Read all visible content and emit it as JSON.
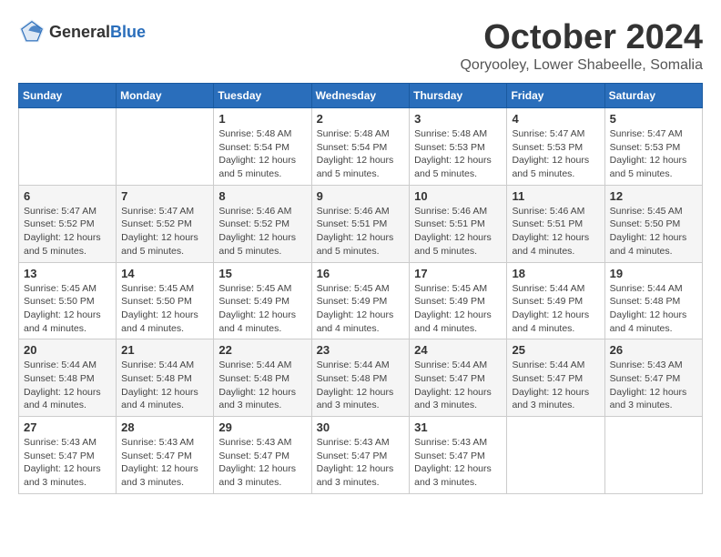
{
  "header": {
    "logo_general": "General",
    "logo_blue": "Blue",
    "month": "October 2024",
    "location": "Qoryooley, Lower Shabeelle, Somalia"
  },
  "weekdays": [
    "Sunday",
    "Monday",
    "Tuesday",
    "Wednesday",
    "Thursday",
    "Friday",
    "Saturday"
  ],
  "weeks": [
    [
      {
        "day": "",
        "sunrise": "",
        "sunset": "",
        "daylight": ""
      },
      {
        "day": "",
        "sunrise": "",
        "sunset": "",
        "daylight": ""
      },
      {
        "day": "1",
        "sunrise": "Sunrise: 5:48 AM",
        "sunset": "Sunset: 5:54 PM",
        "daylight": "Daylight: 12 hours and 5 minutes."
      },
      {
        "day": "2",
        "sunrise": "Sunrise: 5:48 AM",
        "sunset": "Sunset: 5:54 PM",
        "daylight": "Daylight: 12 hours and 5 minutes."
      },
      {
        "day": "3",
        "sunrise": "Sunrise: 5:48 AM",
        "sunset": "Sunset: 5:53 PM",
        "daylight": "Daylight: 12 hours and 5 minutes."
      },
      {
        "day": "4",
        "sunrise": "Sunrise: 5:47 AM",
        "sunset": "Sunset: 5:53 PM",
        "daylight": "Daylight: 12 hours and 5 minutes."
      },
      {
        "day": "5",
        "sunrise": "Sunrise: 5:47 AM",
        "sunset": "Sunset: 5:53 PM",
        "daylight": "Daylight: 12 hours and 5 minutes."
      }
    ],
    [
      {
        "day": "6",
        "sunrise": "Sunrise: 5:47 AM",
        "sunset": "Sunset: 5:52 PM",
        "daylight": "Daylight: 12 hours and 5 minutes."
      },
      {
        "day": "7",
        "sunrise": "Sunrise: 5:47 AM",
        "sunset": "Sunset: 5:52 PM",
        "daylight": "Daylight: 12 hours and 5 minutes."
      },
      {
        "day": "8",
        "sunrise": "Sunrise: 5:46 AM",
        "sunset": "Sunset: 5:52 PM",
        "daylight": "Daylight: 12 hours and 5 minutes."
      },
      {
        "day": "9",
        "sunrise": "Sunrise: 5:46 AM",
        "sunset": "Sunset: 5:51 PM",
        "daylight": "Daylight: 12 hours and 5 minutes."
      },
      {
        "day": "10",
        "sunrise": "Sunrise: 5:46 AM",
        "sunset": "Sunset: 5:51 PM",
        "daylight": "Daylight: 12 hours and 5 minutes."
      },
      {
        "day": "11",
        "sunrise": "Sunrise: 5:46 AM",
        "sunset": "Sunset: 5:51 PM",
        "daylight": "Daylight: 12 hours and 4 minutes."
      },
      {
        "day": "12",
        "sunrise": "Sunrise: 5:45 AM",
        "sunset": "Sunset: 5:50 PM",
        "daylight": "Daylight: 12 hours and 4 minutes."
      }
    ],
    [
      {
        "day": "13",
        "sunrise": "Sunrise: 5:45 AM",
        "sunset": "Sunset: 5:50 PM",
        "daylight": "Daylight: 12 hours and 4 minutes."
      },
      {
        "day": "14",
        "sunrise": "Sunrise: 5:45 AM",
        "sunset": "Sunset: 5:50 PM",
        "daylight": "Daylight: 12 hours and 4 minutes."
      },
      {
        "day": "15",
        "sunrise": "Sunrise: 5:45 AM",
        "sunset": "Sunset: 5:49 PM",
        "daylight": "Daylight: 12 hours and 4 minutes."
      },
      {
        "day": "16",
        "sunrise": "Sunrise: 5:45 AM",
        "sunset": "Sunset: 5:49 PM",
        "daylight": "Daylight: 12 hours and 4 minutes."
      },
      {
        "day": "17",
        "sunrise": "Sunrise: 5:45 AM",
        "sunset": "Sunset: 5:49 PM",
        "daylight": "Daylight: 12 hours and 4 minutes."
      },
      {
        "day": "18",
        "sunrise": "Sunrise: 5:44 AM",
        "sunset": "Sunset: 5:49 PM",
        "daylight": "Daylight: 12 hours and 4 minutes."
      },
      {
        "day": "19",
        "sunrise": "Sunrise: 5:44 AM",
        "sunset": "Sunset: 5:48 PM",
        "daylight": "Daylight: 12 hours and 4 minutes."
      }
    ],
    [
      {
        "day": "20",
        "sunrise": "Sunrise: 5:44 AM",
        "sunset": "Sunset: 5:48 PM",
        "daylight": "Daylight: 12 hours and 4 minutes."
      },
      {
        "day": "21",
        "sunrise": "Sunrise: 5:44 AM",
        "sunset": "Sunset: 5:48 PM",
        "daylight": "Daylight: 12 hours and 4 minutes."
      },
      {
        "day": "22",
        "sunrise": "Sunrise: 5:44 AM",
        "sunset": "Sunset: 5:48 PM",
        "daylight": "Daylight: 12 hours and 3 minutes."
      },
      {
        "day": "23",
        "sunrise": "Sunrise: 5:44 AM",
        "sunset": "Sunset: 5:48 PM",
        "daylight": "Daylight: 12 hours and 3 minutes."
      },
      {
        "day": "24",
        "sunrise": "Sunrise: 5:44 AM",
        "sunset": "Sunset: 5:47 PM",
        "daylight": "Daylight: 12 hours and 3 minutes."
      },
      {
        "day": "25",
        "sunrise": "Sunrise: 5:44 AM",
        "sunset": "Sunset: 5:47 PM",
        "daylight": "Daylight: 12 hours and 3 minutes."
      },
      {
        "day": "26",
        "sunrise": "Sunrise: 5:43 AM",
        "sunset": "Sunset: 5:47 PM",
        "daylight": "Daylight: 12 hours and 3 minutes."
      }
    ],
    [
      {
        "day": "27",
        "sunrise": "Sunrise: 5:43 AM",
        "sunset": "Sunset: 5:47 PM",
        "daylight": "Daylight: 12 hours and 3 minutes."
      },
      {
        "day": "28",
        "sunrise": "Sunrise: 5:43 AM",
        "sunset": "Sunset: 5:47 PM",
        "daylight": "Daylight: 12 hours and 3 minutes."
      },
      {
        "day": "29",
        "sunrise": "Sunrise: 5:43 AM",
        "sunset": "Sunset: 5:47 PM",
        "daylight": "Daylight: 12 hours and 3 minutes."
      },
      {
        "day": "30",
        "sunrise": "Sunrise: 5:43 AM",
        "sunset": "Sunset: 5:47 PM",
        "daylight": "Daylight: 12 hours and 3 minutes."
      },
      {
        "day": "31",
        "sunrise": "Sunrise: 5:43 AM",
        "sunset": "Sunset: 5:47 PM",
        "daylight": "Daylight: 12 hours and 3 minutes."
      },
      {
        "day": "",
        "sunrise": "",
        "sunset": "",
        "daylight": ""
      },
      {
        "day": "",
        "sunrise": "",
        "sunset": "",
        "daylight": ""
      }
    ]
  ]
}
